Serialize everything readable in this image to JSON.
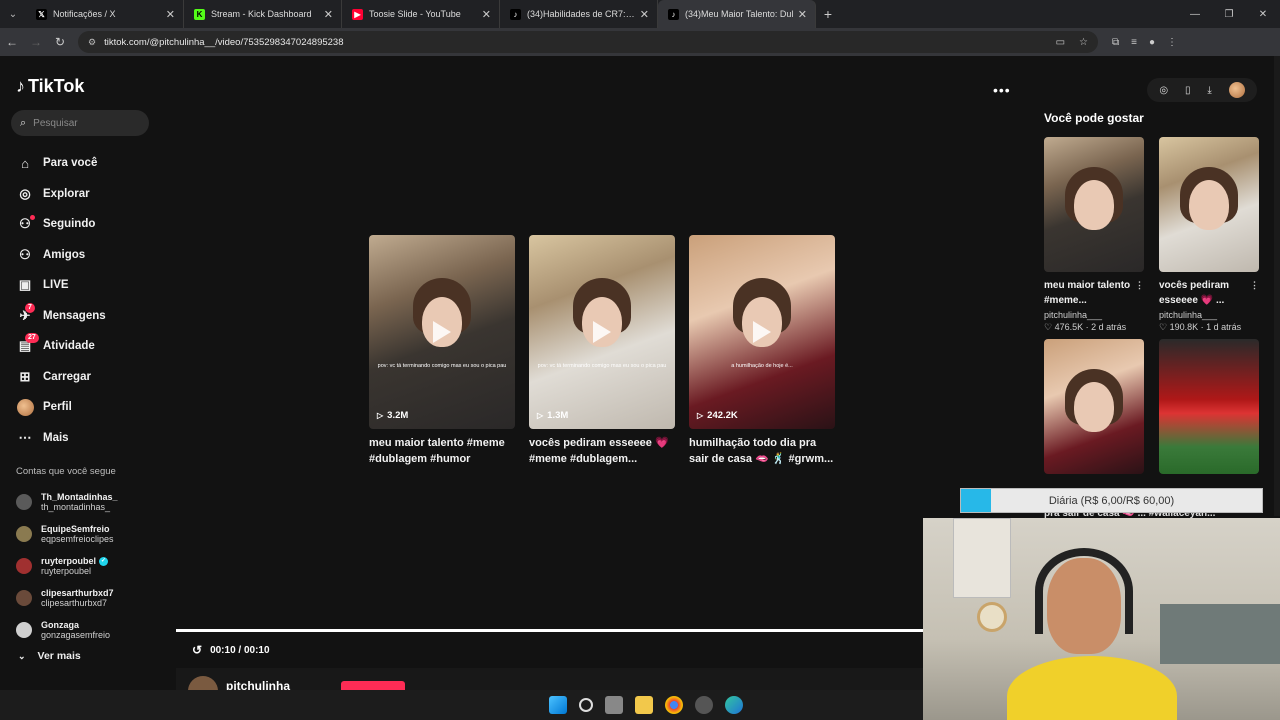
{
  "browser": {
    "tabs": [
      {
        "title": "Notificações / X",
        "icon": "x-logo-icon",
        "active": false
      },
      {
        "title": "Stream - Kick Dashboard",
        "icon": "kick-logo-icon",
        "active": false
      },
      {
        "title": "Toosie Slide - YouTube",
        "icon": "youtube-logo-icon",
        "active": false
      },
      {
        "title": "(34)Habilidades de CR7: Domin",
        "icon": "tiktok-logo-icon",
        "active": false
      },
      {
        "title": "(34)Meu Maior Talento: Dul",
        "icon": "tiktok-logo-icon",
        "active": true
      }
    ],
    "url": "tiktok.com/@pitchulinha__/video/7535298347024895238"
  },
  "sidebar": {
    "logo": "TikTok",
    "search_placeholder": "Pesquisar",
    "nav": [
      {
        "label": "Para você",
        "icon": "home-icon"
      },
      {
        "label": "Explorar",
        "icon": "compass-icon"
      },
      {
        "label": "Seguindo",
        "icon": "following-icon"
      },
      {
        "label": "Amigos",
        "icon": "friends-icon"
      },
      {
        "label": "LIVE",
        "icon": "live-icon"
      },
      {
        "label": "Mensagens",
        "icon": "messages-icon",
        "badge": "7"
      },
      {
        "label": "Atividade",
        "icon": "activity-icon",
        "badge": "27"
      },
      {
        "label": "Carregar",
        "icon": "upload-icon"
      },
      {
        "label": "Perfil",
        "icon": "profile-avatar-icon"
      },
      {
        "label": "Mais",
        "icon": "more-icon"
      }
    ],
    "follows_title": "Contas que você segue",
    "follows": [
      {
        "name": "Th_Montadinhas_",
        "handle": "th_montadinhas_",
        "color": "#5a5a5a"
      },
      {
        "name": "EquipeSemfreio",
        "handle": "eqpsemfreioclipes",
        "color": "#8a7a50"
      },
      {
        "name": "ruyterpoubel",
        "handle": "ruyterpoubel",
        "color": "#a03030",
        "verified": true
      },
      {
        "name": "clipesarthurbxd7",
        "handle": "clipesarthurbxd7",
        "color": "#6a4a3a"
      },
      {
        "name": "Gonzaga",
        "handle": "gonzagasemfreio",
        "color": "#d0d0d0"
      }
    ],
    "see_more": "Ver mais"
  },
  "main": {
    "videos": [
      {
        "views": "3.2M",
        "title": "meu maior talento #meme #dublagem #humor #trend...",
        "caption": "pov: vc tá terminando comigo mas eu sou o pica pau"
      },
      {
        "views": "1.3M",
        "title": "vocês pediram esseeee 💗 #meme #dublagem...",
        "caption": "pov: vc tá terminando comigo mas eu sou o pica pau"
      },
      {
        "views": "242.2K",
        "title": "humilhação todo dia pra sair de casa 🫦 🕺 #grwm...",
        "caption": "a humilhação de hoje é..."
      }
    ],
    "time": "00:10 / 00:10",
    "author": "pitchulinha"
  },
  "recommendations": {
    "title": "Você pode gostar",
    "items": [
      {
        "title": "meu maior talento #meme...",
        "author": "pitchulinha___",
        "likes": "476.5K",
        "age": "2 d atrás"
      },
      {
        "title": "vocês pediram esseeee 💗 ...",
        "author": "pitchulinha___",
        "likes": "190.8K",
        "age": "1 d atrás"
      }
    ],
    "behind_overlay": "pra sair de casa 🫦 ...    #wallaceyan..."
  },
  "overlay": {
    "goal_text": "Diária (R$ 6,00/R$ 60,00)",
    "goal_progress": 0.1
  }
}
